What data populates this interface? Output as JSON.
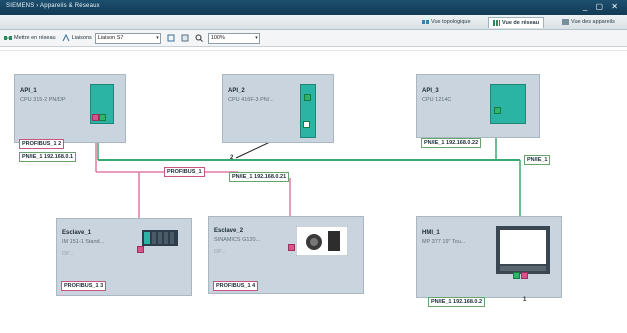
{
  "titlebar": {
    "title": "SIEMENS  ›  Appareils & Réseaux",
    "controls": "_ ▢ ✕"
  },
  "viewtabs": [
    {
      "label": "Vue topologique",
      "active": false
    },
    {
      "label": "Vue de réseau",
      "active": true
    },
    {
      "label": "Vue des appareils",
      "active": false
    }
  ],
  "toolbar": {
    "connect_label": "Mettre en réseau",
    "connections_label": "Liaisons",
    "connection_type": "Liaison S7",
    "zoom": "100%"
  },
  "devices": [
    {
      "id": "api1",
      "name": "API_1",
      "type": "CPU 315-2 PN/DP",
      "dp_label": "PROFIBUS_1 2",
      "pn_label": "PN/IE_1 192.168.0.1"
    },
    {
      "id": "api2",
      "name": "API_2",
      "type": "CPU 416F-3 PN/...",
      "pn_label": "PN/IE_1 192.168.0.21"
    },
    {
      "id": "api3",
      "name": "API_3",
      "type": "CPU 1214C",
      "pn_label": "PN/IE_1 192.168.0.22"
    },
    {
      "id": "esclave1",
      "name": "Esclave_1",
      "type": "IM 151-1 Stand...",
      "sub": "DP...",
      "dp_label": "PROFIBUS_1 3"
    },
    {
      "id": "esclave2",
      "name": "Esclave_2",
      "type": "SINAMICS G120...",
      "sub": "DP...",
      "dp_label": "PROFIBUS_1 4"
    },
    {
      "id": "hmi1",
      "name": "HMI_1",
      "type": "MP 377 19\" Tou...",
      "pn_label": "PN/IE_1 192.168.0.2"
    }
  ],
  "networks": {
    "profibus": "PROFIBUS_1",
    "pnie": "PN/IE_1",
    "api2_port": "2",
    "hmi_port": "1"
  },
  "colors": {
    "pnie": "#3aa873",
    "profibus": "#e07aa3",
    "device_bg": "#c9d4de",
    "accent": "#2bb3a3"
  }
}
